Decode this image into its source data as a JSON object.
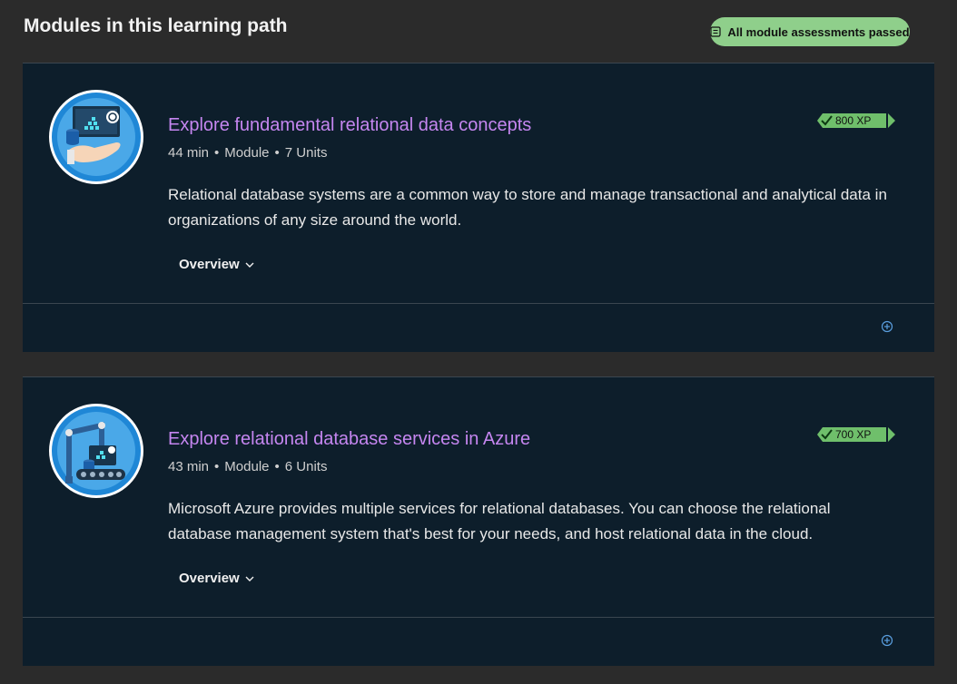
{
  "page": {
    "title": "Modules in this learning path",
    "status_badge": "All module assessments passed",
    "accent_color": "#c586f0",
    "badge_color": "#8fcf8b"
  },
  "modules": [
    {
      "title": "Explore fundamental relational data concepts",
      "duration": "44 min",
      "type": "Module",
      "units": "7 Units",
      "description": "Relational database systems are a common way to store and manage transactional and analytical data in organizations of any size around the world.",
      "overview_label": "Overview",
      "xp": "800 XP",
      "icon": "database-hand-icon"
    },
    {
      "title": "Explore relational database services in Azure",
      "duration": "43 min",
      "type": "Module",
      "units": "6 Units",
      "description": "Microsoft Azure provides multiple services for relational databases. You can choose the relational database management system that's best for your needs, and host relational data in the cloud.",
      "overview_label": "Overview",
      "xp": "700 XP",
      "icon": "robot-arm-database-icon"
    }
  ]
}
